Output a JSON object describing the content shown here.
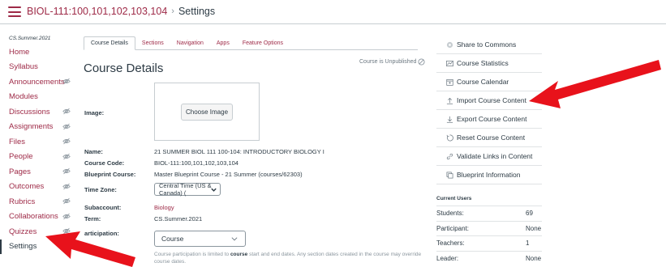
{
  "header": {
    "course_code": "BIOL-111:100,101,102,103,104",
    "separator": "›",
    "current_page": "Settings"
  },
  "sidebar": {
    "term": "CS.Summer.2021",
    "items": [
      {
        "label": "Home",
        "hidden": false
      },
      {
        "label": "Syllabus",
        "hidden": false
      },
      {
        "label": "Announcements",
        "hidden": true
      },
      {
        "label": "Modules",
        "hidden": false
      },
      {
        "label": "Discussions",
        "hidden": true
      },
      {
        "label": "Assignments",
        "hidden": true
      },
      {
        "label": "Files",
        "hidden": true
      },
      {
        "label": "People",
        "hidden": true
      },
      {
        "label": "Pages",
        "hidden": true
      },
      {
        "label": "Outcomes",
        "hidden": true
      },
      {
        "label": "Rubrics",
        "hidden": true
      },
      {
        "label": "Collaborations",
        "hidden": true
      },
      {
        "label": "Quizzes",
        "hidden": true
      },
      {
        "label": "Settings",
        "hidden": false,
        "active": true
      }
    ]
  },
  "tabs": [
    {
      "label": "Course Details",
      "active": true
    },
    {
      "label": "Sections"
    },
    {
      "label": "Navigation"
    },
    {
      "label": "Apps"
    },
    {
      "label": "Feature Options"
    }
  ],
  "main": {
    "title": "Course Details",
    "status": "Course is Unpublished",
    "image_label": "Image:",
    "choose_image": "Choose Image",
    "name_label": "Name:",
    "name_value": "21 SUMMER BIOL 111 100-104: INTRODUCTORY BIOLOGY I",
    "code_label": "Course Code:",
    "code_value": "BIOL-111:100,101,102,103,104",
    "blueprint_label": "Blueprint Course:",
    "blueprint_value": "Master Blueprint Course - 21 Summer (courses/62303)",
    "timezone_label": "Time Zone:",
    "timezone_value": "Central Time (US & Canada) (",
    "subaccount_label": "Subaccount:",
    "subaccount_value": "Biology",
    "term_label": "Term:",
    "term_value": "CS.Summer.2021",
    "participation_label": "articipation:",
    "participation_value": "Course",
    "help_pre": "Course participation is limited to ",
    "help_bold": "course",
    "help_post": " start and end dates. Any section dates created in the course may override course dates."
  },
  "right_sidebar": {
    "buttons": [
      {
        "label": "Share to Commons",
        "icon": "share-icon"
      },
      {
        "label": "Course Statistics",
        "icon": "statistics-icon"
      },
      {
        "label": "Course Calendar",
        "icon": "calendar-icon"
      },
      {
        "label": "Import Course Content",
        "icon": "import-icon"
      },
      {
        "label": "Export Course Content",
        "icon": "export-icon"
      },
      {
        "label": "Reset Course Content",
        "icon": "reset-icon"
      },
      {
        "label": "Validate Links in Content",
        "icon": "link-icon"
      },
      {
        "label": "Blueprint Information",
        "icon": "blueprint-icon"
      }
    ],
    "users_heading": "Current Users",
    "users": [
      {
        "role": "Students:",
        "count": "69"
      },
      {
        "role": "Participant:",
        "count": "None"
      },
      {
        "role": "Teachers:",
        "count": "1"
      },
      {
        "role": "Leader:",
        "count": "None"
      }
    ]
  },
  "colors": {
    "link": "#9e2a47",
    "text": "#2d3b45",
    "arrow": "#e8121b"
  }
}
